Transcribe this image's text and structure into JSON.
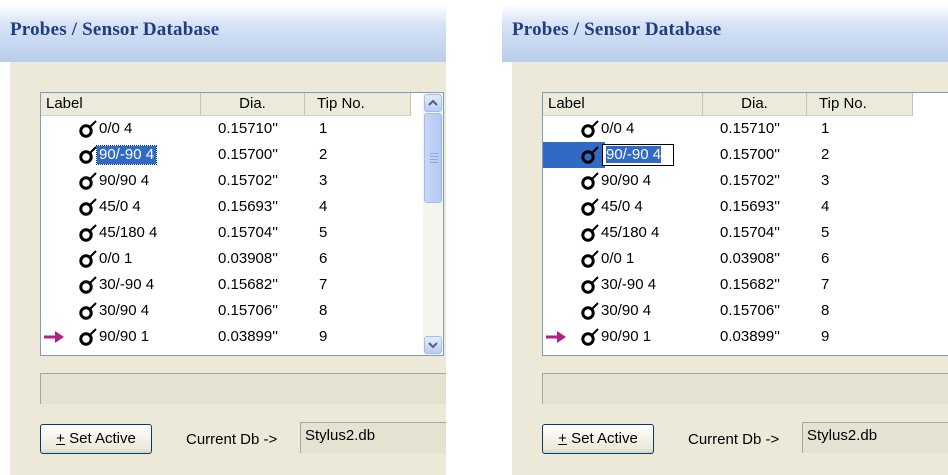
{
  "window": {
    "title": "Probes / Sensor Database"
  },
  "columns": {
    "label": "Label",
    "dia": "Dia.",
    "tip": "Tip No."
  },
  "rows": [
    {
      "label": "0/0 4",
      "dia": "0.15710''",
      "tip": "1"
    },
    {
      "label": "90/-90 4",
      "dia": "0.15700''",
      "tip": "2"
    },
    {
      "label": "90/90 4",
      "dia": "0.15702''",
      "tip": "3"
    },
    {
      "label": "45/0 4",
      "dia": "0.15693''",
      "tip": "4"
    },
    {
      "label": "45/180 4",
      "dia": "0.15704''",
      "tip": "5"
    },
    {
      "label": "0/0 1",
      "dia": "0.03908''",
      "tip": "6"
    },
    {
      "label": "30/-90 4",
      "dia": "0.15682''",
      "tip": "7"
    },
    {
      "label": "30/90 4",
      "dia": "0.15706''",
      "tip": "8"
    },
    {
      "label": "90/90 1",
      "dia": "0.03899''",
      "tip": "9"
    }
  ],
  "selected_row": "90/-90 4",
  "active_row": "90/90 1",
  "edit_value": "90/-90 4",
  "footer": {
    "set_active_prefix": "+",
    "set_active_label": " Set Active",
    "current_db_label": "Current Db ->",
    "current_db_value": "Stylus2.db"
  },
  "icons": {
    "probe": "probe-icon",
    "active": "active-arrow-icon"
  },
  "colors": {
    "title": "#1f3d80",
    "selection": "#316ac5",
    "arrow": "#b0208a"
  }
}
